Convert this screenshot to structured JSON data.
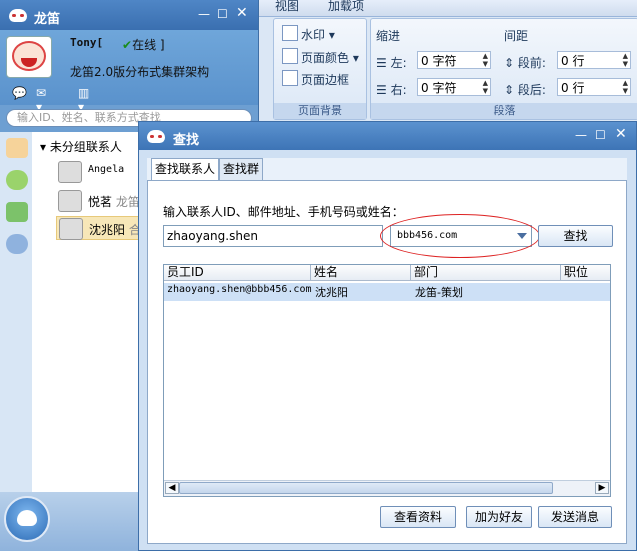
{
  "word": {
    "tabs": [
      "视图",
      "加载项"
    ],
    "watermark": "水印",
    "page_color": "页面颜色",
    "page_border": "页面边框",
    "page_bg_caption": "页面背景",
    "indent_title": "缩进",
    "spacing_title": "间距",
    "indent_left_label": "左:",
    "indent_left_value": "0 字符",
    "indent_right_label": "右:",
    "indent_right_value": "0 字符",
    "space_before_label": "段前:",
    "space_before_value": "0 行",
    "space_after_label": "段后:",
    "space_after_value": "0 行",
    "paragraph_caption": "段落"
  },
  "main": {
    "title": "龙笛",
    "nickname": "Tony[",
    "status": "在线 ]",
    "signature": "龙笛2.0版分布式集群架构",
    "search_placeholder": "输入ID、姓名、联系方式查找",
    "group_label": "未分组联系人",
    "contacts": [
      {
        "name": "Angela",
        "sub": ""
      },
      {
        "name": "悦茗",
        "sub": "龙笛"
      },
      {
        "name": "沈兆阳",
        "sub": "合"
      }
    ]
  },
  "dialog": {
    "title": "查找",
    "tabs": [
      "查找联系人",
      "查找群"
    ],
    "prompt": "输入联系人ID、邮件地址、手机号码或姓名：",
    "input_value": "zhaoyang.shen",
    "domain_value": "bbb456.com",
    "search_button": "查找",
    "columns": [
      "员工ID",
      "姓名",
      "部门",
      "职位"
    ],
    "rows": [
      {
        "id": "zhaoyang.shen@bbb456.com",
        "name": "沈兆阳",
        "dept": "龙笛-策划",
        "title": ""
      }
    ],
    "buttons": {
      "view": "查看资料",
      "add": "加为好友",
      "send": "发送消息"
    }
  }
}
